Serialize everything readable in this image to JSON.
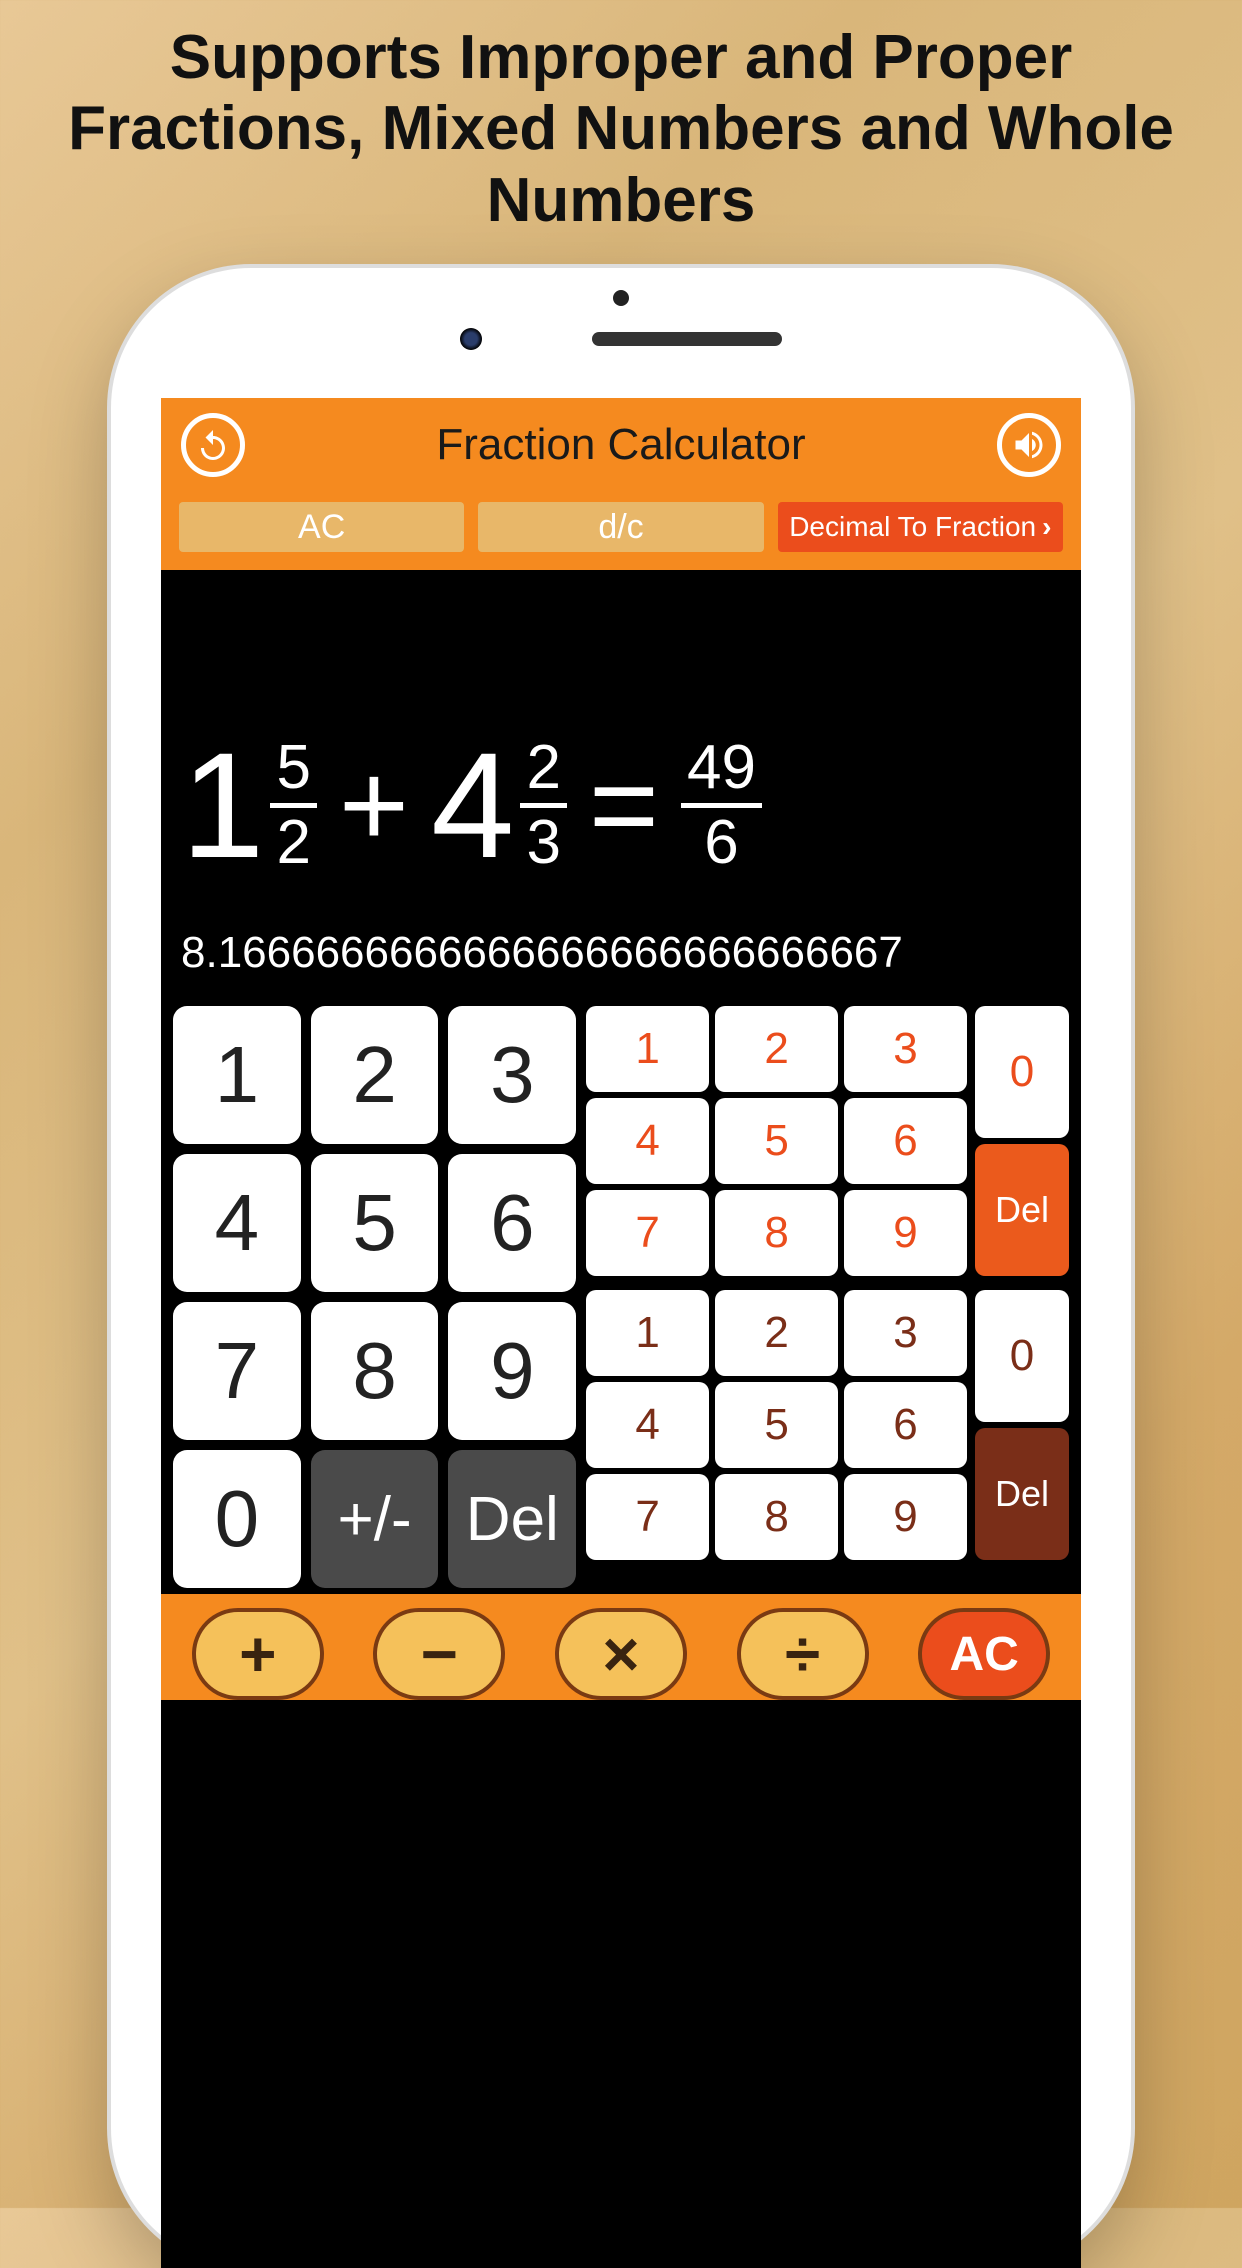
{
  "promo_headline": "Supports Improper and Proper Fractions, Mixed Numbers and Whole Numbers",
  "header": {
    "title": "Fraction Calculator"
  },
  "toolbar": {
    "ac": "AC",
    "dc": "d/c",
    "decimal_to_fraction": "Decimal To Fraction"
  },
  "equation": {
    "term1": {
      "whole": "1",
      "num": "5",
      "den": "2"
    },
    "op": "+",
    "term2": {
      "whole": "4",
      "num": "2",
      "den": "3"
    },
    "eq": "=",
    "result": {
      "num": "49",
      "den": "6"
    }
  },
  "decimal_result": "8.1666666666666666666666666667",
  "main_keys": [
    "1",
    "2",
    "3",
    "4",
    "5",
    "6",
    "7",
    "8",
    "9",
    "0",
    "+/-",
    "Del"
  ],
  "numer_keys": [
    "1",
    "2",
    "3",
    "4",
    "5",
    "6",
    "7",
    "8",
    "9"
  ],
  "numer_side": [
    "0",
    "Del"
  ],
  "denom_keys": [
    "1",
    "2",
    "3",
    "4",
    "5",
    "6",
    "7",
    "8",
    "9"
  ],
  "denom_side": [
    "0",
    "Del"
  ],
  "op_row": {
    "plus": "+",
    "minus": "−",
    "times": "×",
    "div": "÷",
    "ac": "AC"
  }
}
